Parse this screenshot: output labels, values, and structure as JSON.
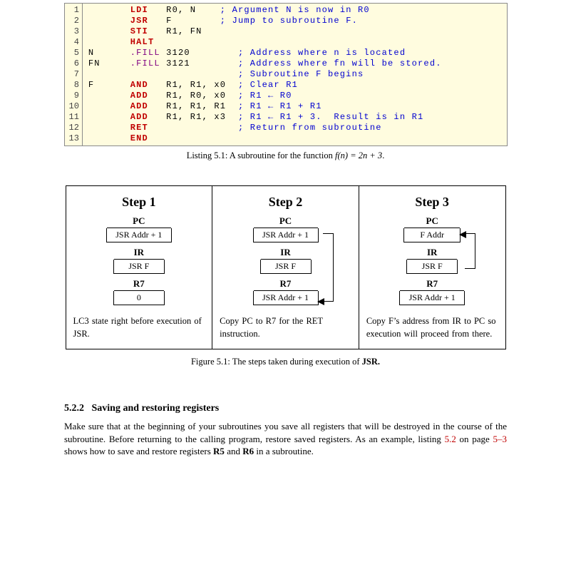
{
  "code": {
    "lines": [
      {
        "n": "1",
        "label": "",
        "op": "LDI",
        "args": "R0, N",
        "comment": "; Argument N is now in R0",
        "opcls": "c-red"
      },
      {
        "n": "2",
        "label": "",
        "op": "JSR",
        "args": "F",
        "comment": "; Jump to subroutine F.",
        "opcls": "c-red"
      },
      {
        "n": "3",
        "label": "",
        "op": "STI",
        "args": "R1, FN",
        "comment": "",
        "opcls": "c-red"
      },
      {
        "n": "4",
        "label": "",
        "op": "HALT",
        "args": "",
        "comment": "",
        "opcls": "c-red"
      },
      {
        "n": "5",
        "label": "N",
        "op": ".FILL",
        "args": "3120",
        "comment": "; Address where n is located",
        "opcls": "c-purp"
      },
      {
        "n": "6",
        "label": "FN",
        "op": ".FILL",
        "args": "3121",
        "comment": "; Address where fn will be stored.",
        "opcls": "c-purp"
      },
      {
        "n": "7",
        "label": "",
        "op": "",
        "args": "",
        "comment": "; Subroutine F begins",
        "opcls": ""
      },
      {
        "n": "8",
        "label": "F",
        "op": "AND",
        "args": "R1, R1, x0",
        "comment": "; Clear R1",
        "opcls": "c-red"
      },
      {
        "n": "9",
        "label": "",
        "op": "ADD",
        "args": "R1, R0, x0",
        "comment": "; R1 ← R0",
        "opcls": "c-red"
      },
      {
        "n": "10",
        "label": "",
        "op": "ADD",
        "args": "R1, R1, R1",
        "comment": "; R1 ← R1 + R1",
        "opcls": "c-red"
      },
      {
        "n": "11",
        "label": "",
        "op": "ADD",
        "args": "R1, R1, x3",
        "comment": "; R1 ← R1 + 3.  Result is in R1",
        "opcls": "c-red"
      },
      {
        "n": "12",
        "label": "",
        "op": "RET",
        "args": "",
        "comment": "; Return from subroutine",
        "opcls": "c-red"
      },
      {
        "n": "13",
        "label": "",
        "op": "END",
        "args": "",
        "comment": "",
        "opcls": "c-red"
      }
    ],
    "caption_prefix": "Listing 5.1: A subroutine for the function ",
    "caption_expr": "f(n) = 2n + 3",
    "caption_suffix": "."
  },
  "figure": {
    "steps": [
      {
        "title": "Step 1",
        "PC": "JSR Addr + 1",
        "IR": "JSR F",
        "R7": "0",
        "desc": "LC3 state right before execution of JSR."
      },
      {
        "title": "Step 2",
        "PC": "JSR Addr + 1",
        "IR": "JSR F",
        "R7": "JSR Addr + 1",
        "desc": "Copy PC to R7 for the RET instruction."
      },
      {
        "title": "Step 3",
        "PC": "F Addr",
        "IR": "JSR F",
        "R7": "JSR Addr + 1",
        "desc": "Copy F’s address from IR to PC so execution will proceed from there."
      }
    ],
    "caption": "Figure 5.1: The steps taken during execution of ",
    "caption_bold": "JSR."
  },
  "section": {
    "number": "5.2.2",
    "title": "Saving and restoring registers",
    "body_pre": "Make sure that at the beginning of your subroutines you save all registers that will be destroyed in the course of the subroutine. Before returning to the calling program, restore saved registers. As an example, listing ",
    "link1": "5.2",
    "body_mid": " on page ",
    "link2": "5–3",
    "body_post": " shows how to save and restore registers ",
    "r5": "R5",
    "and": " and ",
    "r6": "R6",
    "tail": " in a subroutine."
  },
  "labels": {
    "PC": "PC",
    "IR": "IR",
    "R7": "R7"
  }
}
